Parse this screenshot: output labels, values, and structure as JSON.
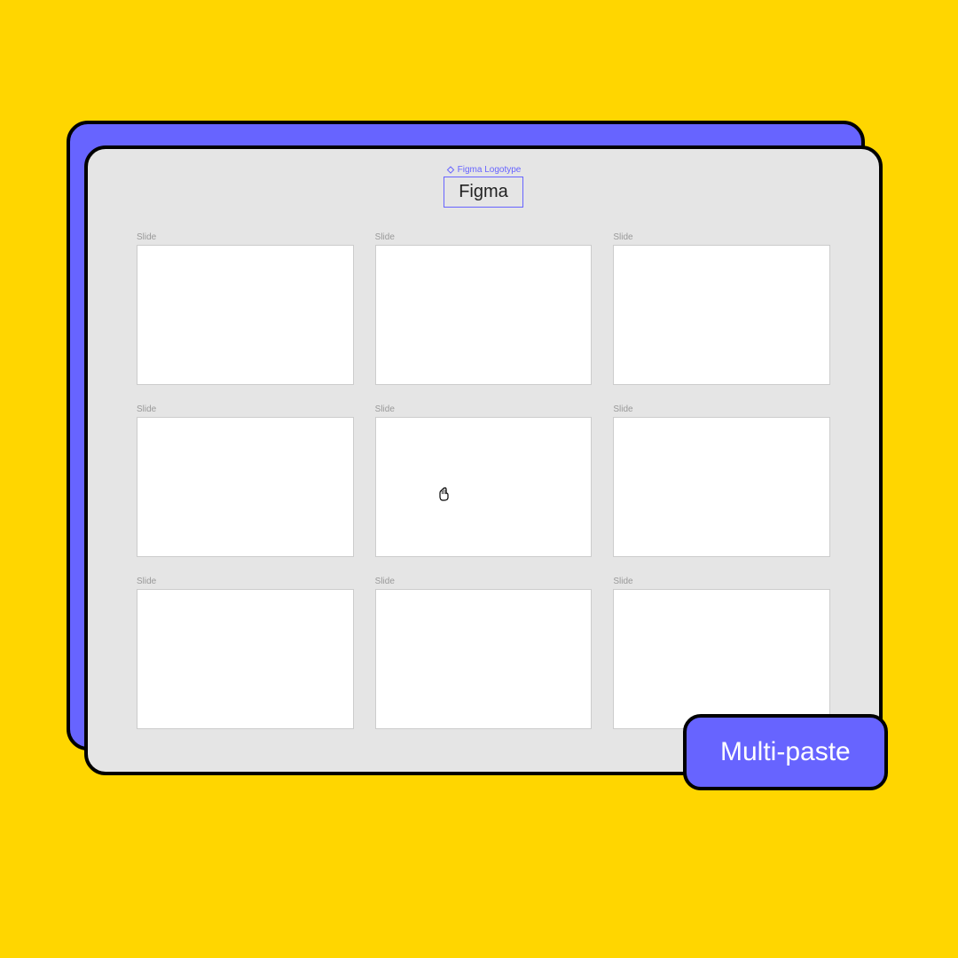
{
  "component": {
    "label": "Figma Logotype",
    "name": "Figma"
  },
  "slides": [
    {
      "label": "Slide"
    },
    {
      "label": "Slide"
    },
    {
      "label": "Slide"
    },
    {
      "label": "Slide"
    },
    {
      "label": "Slide"
    },
    {
      "label": "Slide"
    },
    {
      "label": "Slide"
    },
    {
      "label": "Slide"
    },
    {
      "label": "Slide"
    }
  ],
  "feature": {
    "title": "Multi-paste"
  },
  "colors": {
    "background": "#FFD600",
    "accent": "#6764FF",
    "panel": "#E5E5E5"
  }
}
